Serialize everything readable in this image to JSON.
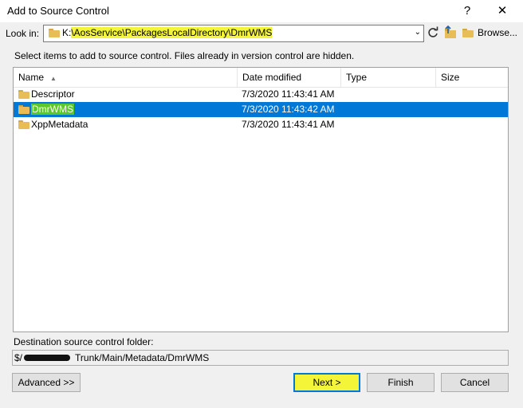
{
  "window": {
    "title": "Add to Source Control",
    "help_glyph": "?",
    "close_glyph": "✕"
  },
  "look_in": {
    "label": "Look in:",
    "drive": "K:",
    "path": "\\AosService\\PackagesLocalDirectory\\DmrWMS",
    "dropdown_glyph": "⌄"
  },
  "toolbar": {
    "refresh_icon": "refresh-icon",
    "up_icon": "up-folder-icon",
    "browse_label": "Browse..."
  },
  "instructions": "Select items to add to source control. Files already in version control are hidden.",
  "list": {
    "columns": [
      "Name",
      "Date modified",
      "Type",
      "Size"
    ],
    "sort_indicator": "▲",
    "rows": [
      {
        "name": "Descriptor",
        "date": "7/3/2020 11:43:41 AM",
        "type": "",
        "size": "",
        "selected": false
      },
      {
        "name": "DmrWMS",
        "date": "7/3/2020 11:43:42 AM",
        "type": "",
        "size": "",
        "selected": true
      },
      {
        "name": "XppMetadata",
        "date": "7/3/2020 11:43:41 AM",
        "type": "",
        "size": "",
        "selected": false
      }
    ]
  },
  "destination": {
    "label": "Destination source control folder:",
    "prefix": "$/",
    "suffix": "Trunk/Main/Metadata/DmrWMS"
  },
  "buttons": {
    "advanced": "Advanced >>",
    "next": "Next >",
    "finish": "Finish",
    "cancel": "Cancel"
  },
  "colors": {
    "selection": "#0078d7",
    "highlighter_yellow": "#f4f439",
    "highlighter_green": "#5cc92a",
    "folder": "#e8bd57"
  }
}
